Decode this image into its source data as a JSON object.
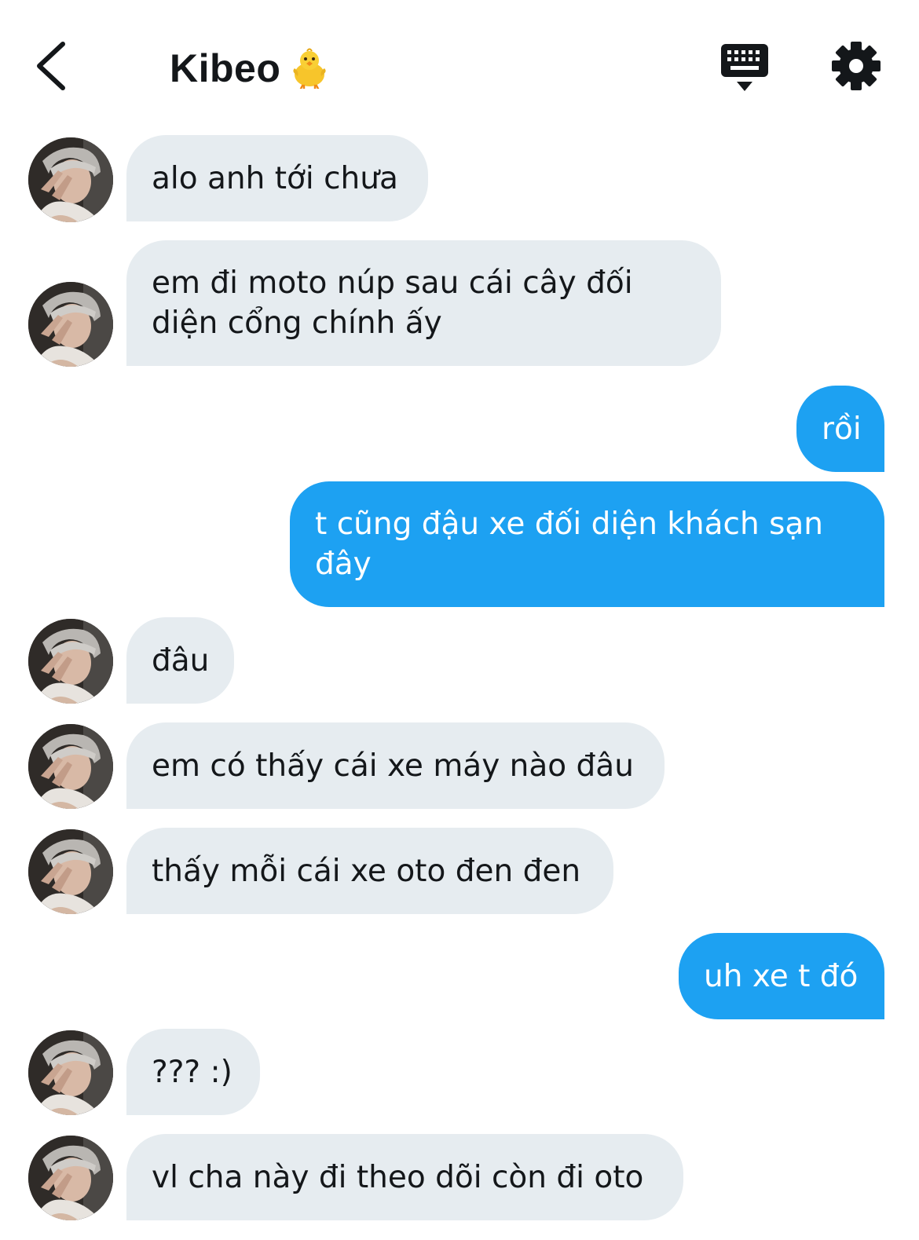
{
  "header": {
    "title": "Kibeo",
    "title_emoji": "🐥"
  },
  "icons": {
    "back": "chevron-left-icon",
    "keyboard": "keyboard-icon",
    "settings": "gear-icon"
  },
  "colors": {
    "outgoing_bubble": "#1da1f2",
    "incoming_bubble": "#e6ecf0",
    "text_dark": "#14171a"
  },
  "messages": [
    {
      "from": "them",
      "text": "alo anh tới chưa"
    },
    {
      "from": "them",
      "text": "em đi moto núp sau cái cây đối diện cổng chính ấy"
    },
    {
      "from": "me",
      "text": "rồi"
    },
    {
      "from": "me",
      "text": "t cũng đậu xe đối diện khách sạn đây"
    },
    {
      "from": "them",
      "text": "đâu"
    },
    {
      "from": "them",
      "text": "em có thấy cái xe máy nào đâu"
    },
    {
      "from": "them",
      "text": "thấy mỗi cái xe oto đen đen"
    },
    {
      "from": "me",
      "text": "uh xe t đó"
    },
    {
      "from": "them",
      "text": "??? :)"
    },
    {
      "from": "them",
      "text": "vl cha này đi theo dõi còn đi oto"
    }
  ]
}
